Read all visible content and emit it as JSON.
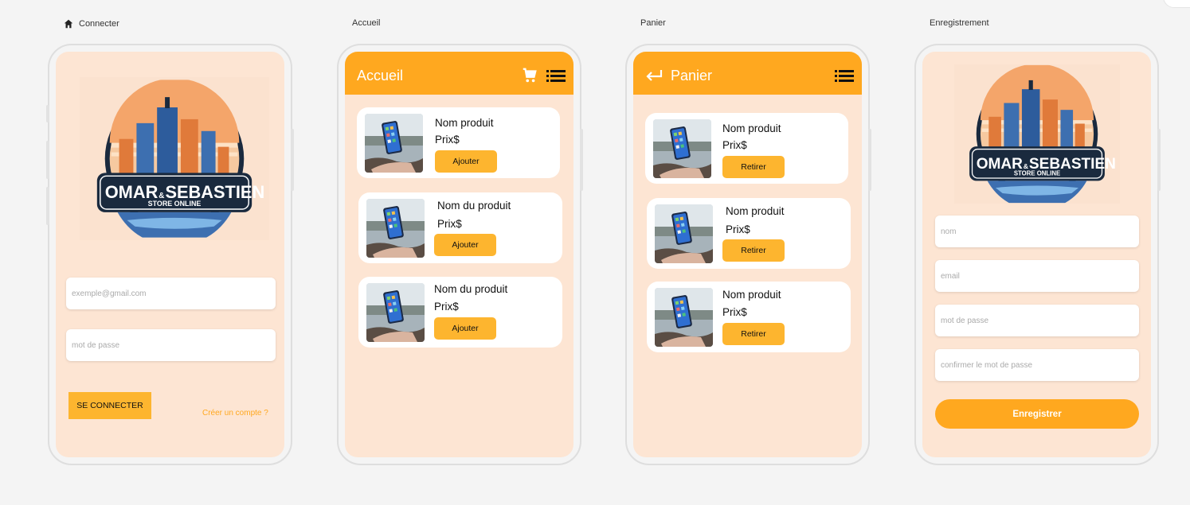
{
  "frames": {
    "login": "Connecter",
    "home": "Accueil",
    "cart": "Panier",
    "register": "Enregistrement"
  },
  "logo": {
    "line1a": "OMAR",
    "amp": "&",
    "line1b": "SEBASTIEN",
    "line2": "STORE ONLINE"
  },
  "login": {
    "email_placeholder": "exemple@gmail.com",
    "password_placeholder": "mot de passe",
    "submit_label": "SE CONNECTER",
    "create_account_link": "Créer un compte ?"
  },
  "home": {
    "title": "Accueil",
    "products": [
      {
        "name": "Nom produit",
        "price": "Prix$",
        "action": "Ajouter"
      },
      {
        "name": "Nom du produit",
        "price": "Prix$",
        "action": "Ajouter"
      },
      {
        "name": "Nom du produit",
        "price": "Prix$",
        "action": "Ajouter"
      }
    ]
  },
  "cart": {
    "title": "Panier",
    "items": [
      {
        "name": "Nom produit",
        "price": "Prix$",
        "action": "Retirer"
      },
      {
        "name": "Nom produit",
        "price": "Prix$",
        "action": "Retirer"
      },
      {
        "name": "Nom produit",
        "price": "Prix$",
        "action": "Retirer"
      }
    ]
  },
  "register": {
    "name_placeholder": "nom",
    "email_placeholder": "email",
    "password_placeholder": "mot de passe",
    "confirm_placeholder": "confirmer le mot de passe",
    "submit_label": "Enregistrer"
  },
  "colors": {
    "accent": "#ffa81f",
    "button": "#fdb52f",
    "screen_bg": "#fde5d3",
    "canvas": "#f4f4f4"
  },
  "icons": [
    "home-icon",
    "cart-icon",
    "list-icon",
    "back-arrow-icon"
  ]
}
